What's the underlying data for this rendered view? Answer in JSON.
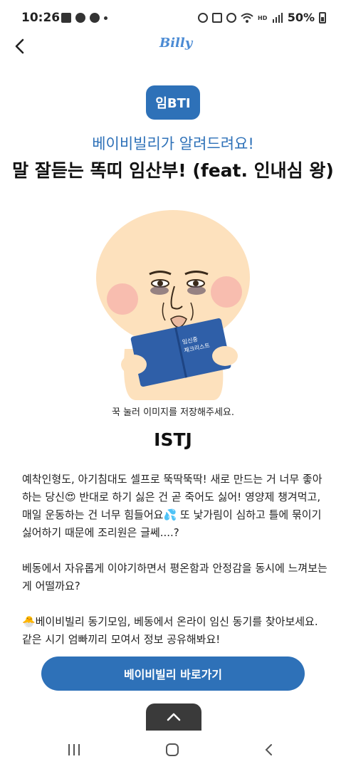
{
  "status_bar": {
    "time": "10:26",
    "battery": "50%",
    "icons": [
      "gallery-icon",
      "cloud-icon",
      "robot-icon",
      "alarm-icon",
      "mute-icon",
      "location-icon",
      "wifi-icon",
      "hd-voice-icon",
      "signal-icon",
      "battery-icon"
    ]
  },
  "header": {
    "logo": "Billy",
    "back_icon": "chevron-left-icon"
  },
  "badge": "임BTI",
  "subtitle": "베이비빌리가 알려드려요!",
  "title": "말 잘듣는 똑띠 임산부! (feat. 인내심 왕)",
  "illustration": {
    "book_text_line1": "임신중",
    "book_text_line2": "체크리스트"
  },
  "caption": "꾹 눌러 이미지를 저장해주세요.",
  "type_code": "ISTJ",
  "description": [
    "예착인형도, 아기침대도 셀프로 뚝딱뚝딱! 새로 만드는 거 너무 좋아하는 당신😍 반대로 하기 싫은 건 곧 죽어도 싫어! 영양제 챙겨먹고, 매일 운동하는 건 너무 힘들어요💦 또 낯가림이 심하고 틀에 묶이기 싫어하기 때문에 조리원은 글쎄....?",
    "베동에서 자유롭게 이야기하면서 평온함과 안정감을 동시에 느껴보는 게 어떨까요?",
    "🐣베이비빌리 동기모임, 베동에서 온라이 임신 동기를 찾아보세요. 같은 시기 엄빠끼리 모여서 정보 공유해봐요!"
  ],
  "cta_label": "베이비빌리 바로가기",
  "scroll_top_icon": "chevron-up-icon",
  "nav": {
    "recent_icon": "recent-apps-icon",
    "home_icon": "home-icon",
    "back_icon": "back-icon"
  },
  "colors": {
    "accent": "#2e71b8",
    "skin": "#fde1bd",
    "cheek": "#f7b6ad",
    "book": "#2f5fa8"
  }
}
